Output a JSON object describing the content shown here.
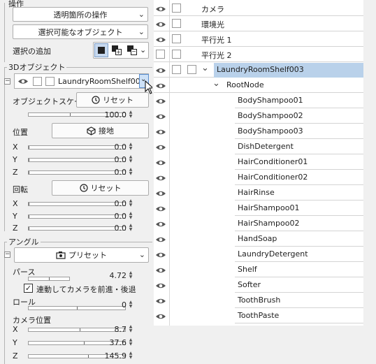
{
  "operation": {
    "title": "操作",
    "transparent_op": "透明箇所の操作",
    "selectable_objects": "選択可能なオブジェクト",
    "add_selection_label": "選択の追加"
  },
  "object3d": {
    "title": "3Dオブジェクト",
    "object_name": "LaundryRoomShelf00",
    "scale_label": "オブジェクトスケール",
    "reset_label": "リセット",
    "scale_value": "100.0",
    "position_label": "位置",
    "ground_label": "接地",
    "pos": [
      {
        "axis": "X",
        "value": "0.0"
      },
      {
        "axis": "Y",
        "value": "0.0"
      },
      {
        "axis": "Z",
        "value": "0.0"
      }
    ],
    "rotation_label": "回転",
    "rotation_reset_label": "リセット",
    "rot": [
      {
        "axis": "X",
        "value": "0.0"
      },
      {
        "axis": "Y",
        "value": "0.0"
      },
      {
        "axis": "Z",
        "value": "0.0"
      }
    ]
  },
  "angle": {
    "title": "アングル",
    "preset_label": "プリセット",
    "perspective_label": "パース",
    "perspective_value": "4.72",
    "link_camera_label": "連動してカメラを前進・後退",
    "roll_label": "ロール",
    "roll_value": "0",
    "camera_pos_label": "カメラ位置",
    "cam": [
      {
        "axis": "X",
        "value": "8.7"
      },
      {
        "axis": "Y",
        "value": "37.6"
      },
      {
        "axis": "Z",
        "value": "145.9"
      }
    ]
  },
  "tree": {
    "items": [
      {
        "name": "カメラ"
      },
      {
        "name": "環境光"
      },
      {
        "name": "平行光 1"
      },
      {
        "name": "平行光 2"
      },
      {
        "name": "LaundryRoomShelf003"
      },
      {
        "name": "RootNode"
      },
      {
        "name": "BodyShampoo01"
      },
      {
        "name": "BodyShampoo02"
      },
      {
        "name": "BodyShampoo03"
      },
      {
        "name": "DishDetergent"
      },
      {
        "name": "HairConditioner01"
      },
      {
        "name": "HairConditioner02"
      },
      {
        "name": "HairRinse"
      },
      {
        "name": "HairShampoo01"
      },
      {
        "name": "HairShampoo02"
      },
      {
        "name": "HandSoap"
      },
      {
        "name": "LaundryDetergent"
      },
      {
        "name": "Shelf"
      },
      {
        "name": "Softer"
      },
      {
        "name": "ToothBrush"
      },
      {
        "name": "ToothPaste"
      }
    ]
  }
}
